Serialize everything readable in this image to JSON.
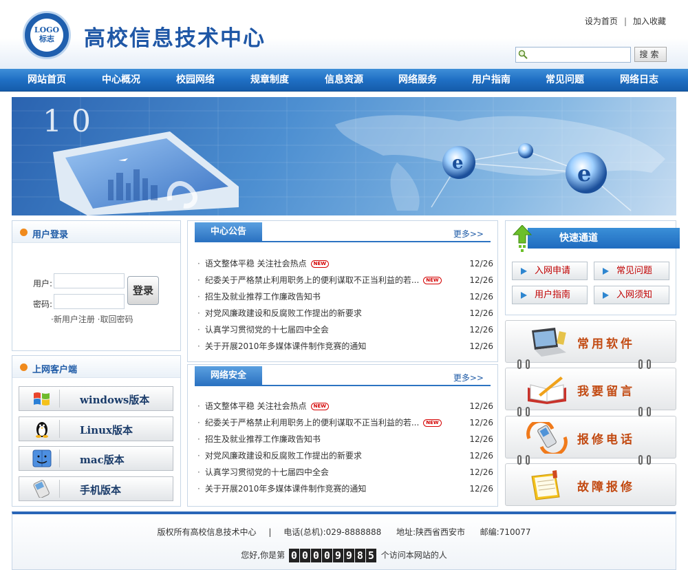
{
  "header": {
    "logo_text_1": "LOGO",
    "logo_text_2": "标志",
    "site_title": "高校信息技术中心",
    "set_home": "设为首页",
    "separator": "|",
    "add_favorite": "加入收藏",
    "search_placeholder": "",
    "search_button": "搜索"
  },
  "nav": [
    "网站首页",
    "中心概况",
    "校园网络",
    "规章制度",
    "信息资源",
    "网络服务",
    "用户指南",
    "常见问题",
    "网络日志"
  ],
  "login": {
    "title": "用户登录",
    "user_label": "用户:",
    "pass_label": "密码:",
    "button": "登录",
    "register": "·新用户注册",
    "recover": "·取回密码"
  },
  "clients": {
    "title": "上网客户端",
    "items": [
      {
        "label": "windows版本",
        "icon": "windows-icon"
      },
      {
        "label": "Linux版本",
        "icon": "linux-icon"
      },
      {
        "label": "mac版本",
        "icon": "mac-icon"
      },
      {
        "label": "手机版本",
        "icon": "mobile-phone-icon"
      }
    ]
  },
  "announcements": {
    "tab": "中心公告",
    "more": "更多>>",
    "items": [
      {
        "title": "语文整体平稳 关注社会热点",
        "date": "12/26",
        "new": true
      },
      {
        "title": "纪委关于严格禁止利用职务上的便利谋取不正当利益的若...",
        "date": "12/26",
        "new": true
      },
      {
        "title": "招生及就业推荐工作廉政告知书",
        "date": "12/26",
        "new": false
      },
      {
        "title": "对党风廉政建设和反腐败工作提出的新要求",
        "date": "12/26",
        "new": false
      },
      {
        "title": "认真学习贯彻党的十七届四中全会",
        "date": "12/26",
        "new": false
      },
      {
        "title": "关于开展2010年多媒体课件制作竞赛的通知",
        "date": "12/26",
        "new": false
      }
    ]
  },
  "security": {
    "tab": "网络安全",
    "more": "更多>>",
    "items": [
      {
        "title": "语文整体平稳 关注社会热点",
        "date": "12/26",
        "new": true
      },
      {
        "title": "纪委关于严格禁止利用职务上的便利谋取不正当利益的若...",
        "date": "12/26",
        "new": true
      },
      {
        "title": "招生及就业推荐工作廉政告知书",
        "date": "12/26",
        "new": false
      },
      {
        "title": "对党风廉政建设和反腐败工作提出的新要求",
        "date": "12/26",
        "new": false
      },
      {
        "title": "认真学习贯彻党的十七届四中全会",
        "date": "12/26",
        "new": false
      },
      {
        "title": "关于开展2010年多媒体课件制作竞赛的通知",
        "date": "12/26",
        "new": false
      }
    ]
  },
  "new_badge": "NEW",
  "quick": {
    "title": "快速通道",
    "buttons": [
      "入网申请",
      "常见问题",
      "用户指南",
      "入网须知"
    ]
  },
  "big_buttons": [
    {
      "label": "常用软件",
      "icon": "laptop-icon"
    },
    {
      "label": "我要留言",
      "icon": "book-pen-icon"
    },
    {
      "label": "报修电话",
      "icon": "phone-icon"
    },
    {
      "label": "故障报修",
      "icon": "notepad-icon"
    }
  ],
  "footer": {
    "copyright": "版权所有高校信息技术中心",
    "sep": "|",
    "phone": "电话(总机):029-8888888",
    "address": "地址:陕西省西安市",
    "postcode": "邮编:710077",
    "visit_prefix": "您好,你是第",
    "visit_count": "00009985",
    "visit_suffix": "个访问本网站的人"
  },
  "colors": {
    "brand_blue": "#1f57a6",
    "nav_blue": "#1f6fc4",
    "accent_orange": "#f08a1c",
    "new_red": "#d40000",
    "big_label": "#c24a12"
  }
}
